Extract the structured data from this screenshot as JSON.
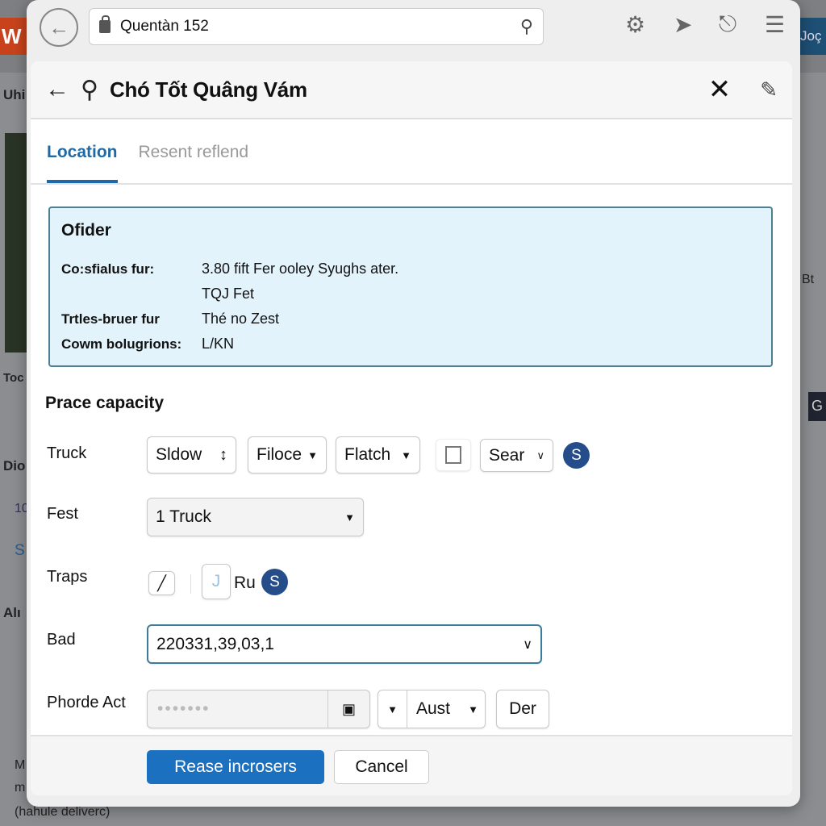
{
  "background": {
    "logo": "W",
    "right_tab": "Joç",
    "left_fragments": [
      "Uhi",
      "Toc",
      "Dio",
      "10",
      "S",
      "Alı",
      "M",
      "m"
    ],
    "left_note": "(hahule deliverc)",
    "right_fragments": [
      "Bt",
      "G"
    ]
  },
  "browser": {
    "address": "Quentàn 152"
  },
  "dialog": {
    "title": "Chó Tốt Quâng Vám",
    "tabs": [
      {
        "label": "Location",
        "active": true
      },
      {
        "label": "Resent reflend",
        "active": false
      }
    ],
    "info": {
      "heading": "Ofider",
      "rows": [
        {
          "key": "Co:sfialus fur:",
          "value": "3.80 fift Fer ooley Syughs ater."
        },
        {
          "key": "",
          "value": "TQJ Fet"
        },
        {
          "key": "Trtles-bruer fur",
          "value": "Thé no Zest"
        },
        {
          "key": "Cowm bolugrions:",
          "value": "L/KN"
        }
      ]
    },
    "section_title": "Prace capacity",
    "fields": {
      "truck": {
        "label": "Truck",
        "controls": [
          "Sldow",
          "Filoce",
          "Flatch",
          "Sear"
        ],
        "checkbox_checked": false,
        "coin": "S"
      },
      "fest": {
        "label": "Fest",
        "value": "1 Truck"
      },
      "traps": {
        "label": "Traps",
        "j_label": "J",
        "text": "Ru",
        "coin": "S"
      },
      "bad": {
        "label": "Bad",
        "value": "220331,39,03,1"
      },
      "phorde": {
        "label": "Phorde Act",
        "password": "•••••••",
        "select": "Aust",
        "button": "Der"
      }
    },
    "buttons": {
      "primary": "Rease incrosers",
      "cancel": "Cancel"
    },
    "accent": "#1e6aa8"
  }
}
